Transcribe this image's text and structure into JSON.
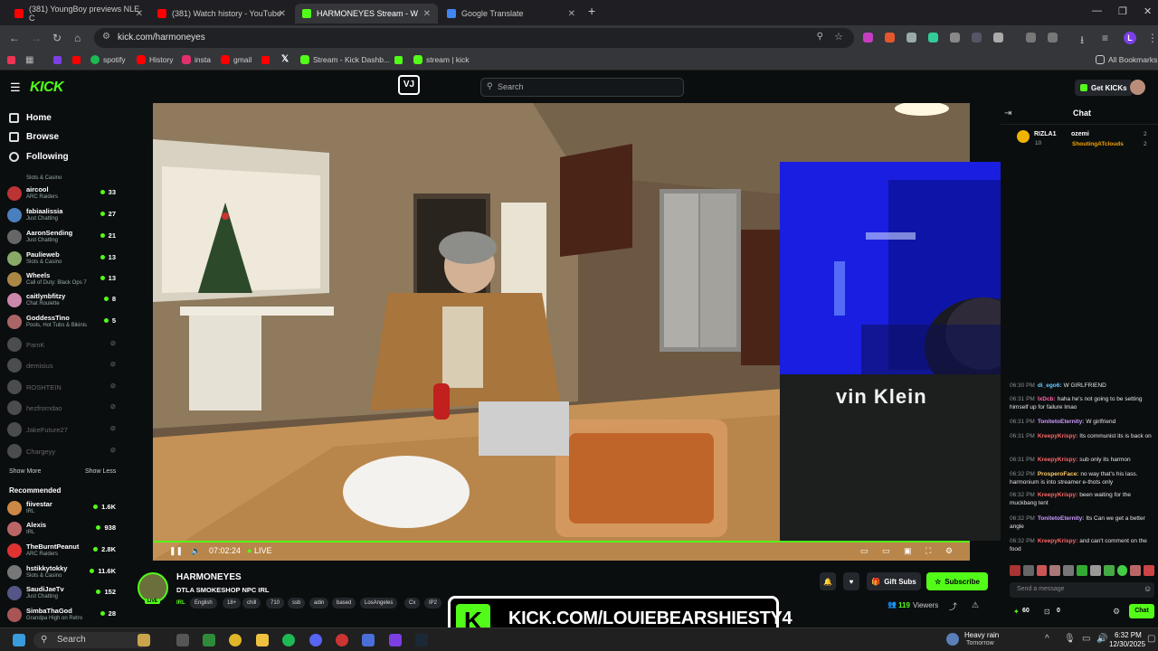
{
  "browser": {
    "tabs": [
      {
        "label": "(381) YoungBoy previews NLE C",
        "color": "#ff0000"
      },
      {
        "label": "(381) Watch history - YouTube",
        "color": "#ff0000"
      },
      {
        "label": "HARMONEYES Stream - W",
        "color": "#53fc18"
      },
      {
        "label": "Google Translate",
        "color": "#4285f4"
      }
    ],
    "url": "kick.com/harmoneyes",
    "bookmarks": [
      {
        "label": "spotify",
        "color": "#1db954"
      },
      {
        "label": "History",
        "color": "#ff0000"
      },
      {
        "label": "insta",
        "color": "#e1306c"
      },
      {
        "label": "gmail",
        "color": "#ff0000"
      },
      {
        "label": "Stream - Kick Dashb...",
        "color": "#53fc18"
      },
      {
        "label": "stream | kick",
        "color": "#53fc18"
      }
    ],
    "all_bookmarks": "All Bookmarks",
    "profile_letter": "L"
  },
  "kick": {
    "logo": "KICK",
    "search_placeholder": "Search",
    "get_kicks": "Get KICKs",
    "nav": [
      "Home",
      "Browse",
      "Following"
    ]
  },
  "sidebar": {
    "following": [
      {
        "name": "",
        "sub": "Slots & Casino",
        "count": "",
        "color": "#888"
      },
      {
        "name": "aircool",
        "sub": "ARC Raiders",
        "count": "33",
        "color": "#b33"
      },
      {
        "name": "fabiaalissia",
        "sub": "Just Chatting",
        "count": "27",
        "color": "#4a7fbf"
      },
      {
        "name": "AaronSending",
        "sub": "Just Chatting",
        "count": "21",
        "color": "#666"
      },
      {
        "name": "Paulieweb",
        "sub": "Slots & Casino",
        "count": "13",
        "color": "#8a6"
      },
      {
        "name": "Wheels",
        "sub": "Call of Duty: Black Ops 7",
        "count": "13",
        "color": "#a84"
      },
      {
        "name": "caitlynbfitzy",
        "sub": "Chat Roulette",
        "count": "8",
        "color": "#c8a"
      },
      {
        "name": "GoddessTino",
        "sub": "Pools, Hot Tubs & Bikinis",
        "count": "5",
        "color": "#a66"
      }
    ],
    "offline": [
      "PamK",
      "demisius",
      "ROSHTEIN",
      "hezfromdao",
      "JakeFuture27",
      "Chargeyy"
    ],
    "show_more": "Show More",
    "show_less": "Show Less",
    "recommended_label": "Recommended",
    "recommended": [
      {
        "name": "fiivestar",
        "sub": "IRL",
        "count": "1.6K",
        "color": "#c84"
      },
      {
        "name": "Alexis",
        "sub": "IRL",
        "count": "938",
        "color": "#b66"
      },
      {
        "name": "TheBurntPeanut",
        "sub": "ARC Raiders",
        "count": "2.8K",
        "color": "#d33"
      },
      {
        "name": "hstikkytokky",
        "sub": "Slots & Casino",
        "count": "11.6K",
        "color": "#777"
      },
      {
        "name": "SaudiJaeTv",
        "sub": "Just Chatting",
        "count": "152",
        "color": "#558"
      },
      {
        "name": "SimbaThaGod",
        "sub": "Grandpa High on Retro",
        "count": "28",
        "color": "#a55"
      }
    ]
  },
  "player": {
    "time": "07:02:24",
    "live": "LIVE"
  },
  "stream": {
    "streamer": "HARMONEYES",
    "title": "DTLA SMOKESHOP NPC IRL",
    "tags": [
      "IRL",
      "English",
      "18+",
      "chill",
      "710",
      "ssb",
      "adin",
      "based",
      "LosAngeles",
      "Cx",
      "IP2"
    ],
    "gift_subs": "Gift Subs",
    "subscribe": "Subscribe",
    "viewers": "119",
    "viewers_label": "Viewers"
  },
  "overlay": {
    "text": "KICK.COM/LOUIEBEARSHIESTY4"
  },
  "chat": {
    "header": "Chat",
    "pinned": [
      {
        "user": "RIZLA1",
        "count": "10"
      },
      {
        "user": "ozemi",
        "count": "2"
      },
      {
        "user": "ShoutingATclouds",
        "count": "2"
      }
    ],
    "messages": [
      {
        "time": "06:30 PM",
        "user": "di_ego6:",
        "color": "#6cf",
        "text": "W GIRLFRIEND"
      },
      {
        "time": "06:31 PM",
        "user": "lxDcb:",
        "color": "#f6a",
        "text": "haha he's not going to be setting himself up for failure lmao"
      },
      {
        "time": "06:31 PM",
        "user": "TonitetoEternity:",
        "color": "#c9f",
        "text": "W girlfriend"
      },
      {
        "time": "06:31 PM",
        "user": "KreepyKrispy:",
        "color": "#f66",
        "text": "Its communist its is back on"
      },
      {
        "time": "06:31 PM",
        "user": "KreepyKrispy:",
        "color": "#f66",
        "text": "sub only its harmon"
      },
      {
        "time": "06:32 PM",
        "user": "ProsperoFace:",
        "color": "#fc6",
        "text": "no way that's his lass. harmonium is into streamer e-thots only"
      },
      {
        "time": "06:32 PM",
        "user": "KreepyKrispy:",
        "color": "#f66",
        "text": "been waiting for the muckbang tent"
      },
      {
        "time": "06:32 PM",
        "user": "TonitetoEternity:",
        "color": "#c9f",
        "text": "Its Can we get a better angle"
      },
      {
        "time": "06:32 PM",
        "user": "KreepyKrispy:",
        "color": "#f66",
        "text": "and can't comment on the food"
      }
    ],
    "send_placeholder": "Send a message",
    "points": "60",
    "zero": "0",
    "chat_button": "Chat"
  },
  "taskbar": {
    "search": "Search",
    "weather": "Heavy rain",
    "weather_sub": "Tomorrow",
    "time": "6:32 PM",
    "date": "12/30/2025"
  }
}
